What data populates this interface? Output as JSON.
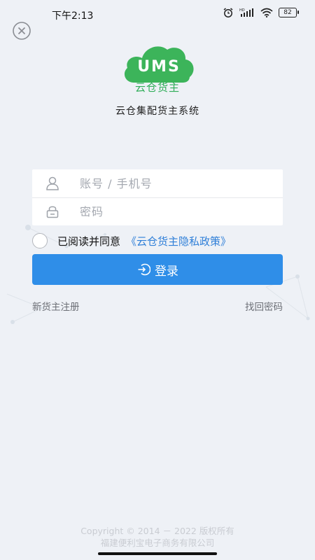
{
  "status_bar": {
    "time": "下午2:13",
    "battery": "82",
    "icons": [
      "alarm-icon",
      "hd-signal-icon",
      "wifi-icon",
      "battery-icon"
    ]
  },
  "logo": {
    "text": "UMS",
    "subtitle": "云仓货主",
    "brand_color": "#3cb45a"
  },
  "app_title": "云仓集配货主系统",
  "form": {
    "account_placeholder": "账号 / 手机号",
    "password_placeholder": "密码"
  },
  "agreement": {
    "text": "已阅读并同意",
    "link": "《云仓货主隐私政策》"
  },
  "login_button": {
    "label": "登录",
    "color": "#2f8ee8"
  },
  "links": {
    "register": "新货主注册",
    "forgot": "找回密码"
  },
  "footer": {
    "copyright": "Copyright © 2014 － 2022 版权所有",
    "company": "福建便利宝电子商务有限公司"
  }
}
